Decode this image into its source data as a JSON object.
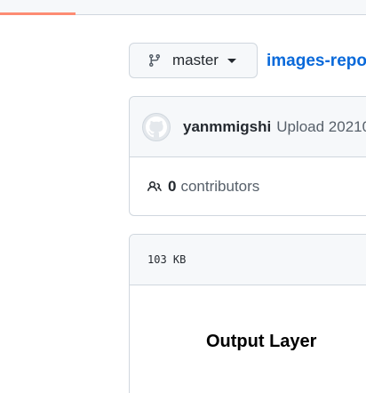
{
  "branch": {
    "name": "master"
  },
  "repo": {
    "link_text": "images-repo"
  },
  "commit": {
    "author": "yanmmigshi",
    "message": "Upload 20210"
  },
  "contributors": {
    "count": "0",
    "label": "contributors"
  },
  "file": {
    "size": "103 KB",
    "preview_text": "Output Layer"
  },
  "icons": {
    "branch": "git-branch-icon",
    "people": "people-icon",
    "avatar": "github-avatar-icon"
  },
  "colors": {
    "link": "#0969da",
    "accent_tab": "#fd8c73"
  }
}
